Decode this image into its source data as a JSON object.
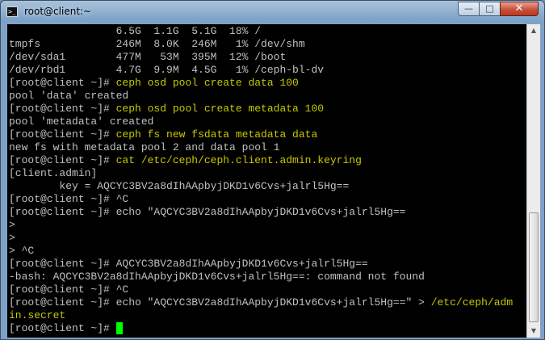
{
  "window": {
    "title": "root@client:~",
    "app_icon_glyph": ">_",
    "buttons": {
      "minimize": "—",
      "maximize": "□",
      "close": "✕"
    }
  },
  "scrollbar": {
    "up": "▲",
    "down": "▼"
  },
  "colors": {
    "background": "#000000",
    "output": "#c0c0c0",
    "command": "#c8c800",
    "cursor": "#00ff00"
  },
  "terminal": {
    "lines": [
      {
        "prompt": "",
        "cmd": "",
        "text": "                 6.5G  1.1G  5.1G  18% /"
      },
      {
        "prompt": "",
        "cmd": "",
        "text": "tmpfs            246M  8.0K  246M   1% /dev/shm"
      },
      {
        "prompt": "",
        "cmd": "",
        "text": "/dev/sda1        477M   53M  395M  12% /boot"
      },
      {
        "prompt": "",
        "cmd": "",
        "text": "/dev/rbd1        4.7G  9.9M  4.5G   1% /ceph-bl-dv"
      },
      {
        "prompt": "[root@client ~]# ",
        "cmd": "ceph osd pool create data 100",
        "text": ""
      },
      {
        "prompt": "",
        "cmd": "",
        "text": "pool 'data' created"
      },
      {
        "prompt": "[root@client ~]# ",
        "cmd": "ceph osd pool create metadata 100",
        "text": ""
      },
      {
        "prompt": "",
        "cmd": "",
        "text": "pool 'metadata' created"
      },
      {
        "prompt": "[root@client ~]# ",
        "cmd": "ceph fs new fsdata metadata data",
        "text": ""
      },
      {
        "prompt": "",
        "cmd": "",
        "text": "new fs with metadata pool 2 and data pool 1"
      },
      {
        "prompt": "[root@client ~]# ",
        "cmd": "cat /etc/ceph/ceph.client.admin.keyring",
        "text": ""
      },
      {
        "prompt": "",
        "cmd": "",
        "text": "[client.admin]"
      },
      {
        "prompt": "",
        "cmd": "",
        "text": "        key = AQCYC3BV2a8dIhAApbyjDKD1v6Cvs+jalrl5Hg=="
      },
      {
        "prompt": "[root@client ~]# ",
        "cmd": "",
        "text": "^C"
      },
      {
        "prompt": "[root@client ~]# ",
        "cmd": "",
        "text": "echo \"AQCYC3BV2a8dIhAApbyjDKD1v6Cvs+jalrl5Hg=="
      },
      {
        "prompt": "",
        "cmd": "",
        "text": ">"
      },
      {
        "prompt": "",
        "cmd": "",
        "text": ">"
      },
      {
        "prompt": "",
        "cmd": "",
        "text": "> ^C"
      },
      {
        "prompt": "[root@client ~]# ",
        "cmd": "",
        "text": "AQCYC3BV2a8dIhAApbyjDKD1v6Cvs+jalrl5Hg=="
      },
      {
        "prompt": "",
        "cmd": "",
        "text": "-bash: AQCYC3BV2a8dIhAApbyjDKD1v6Cvs+jalrl5Hg==: command not found"
      },
      {
        "prompt": "[root@client ~]# ",
        "cmd": "",
        "text": "^C"
      },
      {
        "prompt": "[root@client ~]# ",
        "cmd": "/etc/ceph/adm",
        "text": "echo \"AQCYC3BV2a8dIhAApbyjDKD1v6Cvs+jalrl5Hg==\" > ",
        "cmd_after": true
      },
      {
        "prompt": "",
        "cmd": "in.secret",
        "text": ""
      },
      {
        "prompt": "[root@client ~]# ",
        "cmd": "",
        "text": "",
        "cursor": true
      }
    ]
  }
}
